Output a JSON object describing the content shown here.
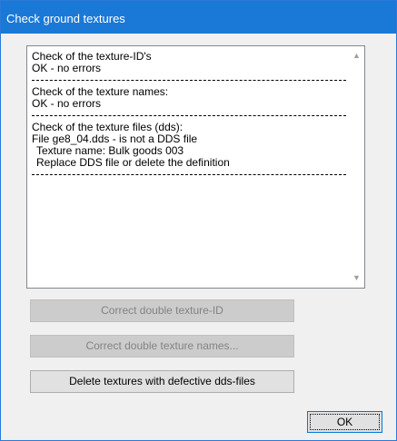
{
  "window": {
    "title": "Check ground textures"
  },
  "report": {
    "lines": [
      "Check of the texture-ID's",
      "OK - no errors",
      "Check of the texture names:",
      "OK - no errors",
      "Check of the texture files (dds):",
      "File ge8_04.dds - is not a DDS file",
      "Texture name: Bulk goods 003",
      "Replace DDS file or delete the definition"
    ],
    "scroll_up_icon": "chevron-up-icon",
    "scroll_down_icon": "chevron-down-icon"
  },
  "buttons": {
    "correct_ids": "Correct double texture-ID",
    "correct_names": "Correct double texture names...",
    "delete_defective": "Delete textures with defective dds-files",
    "ok": "OK"
  }
}
